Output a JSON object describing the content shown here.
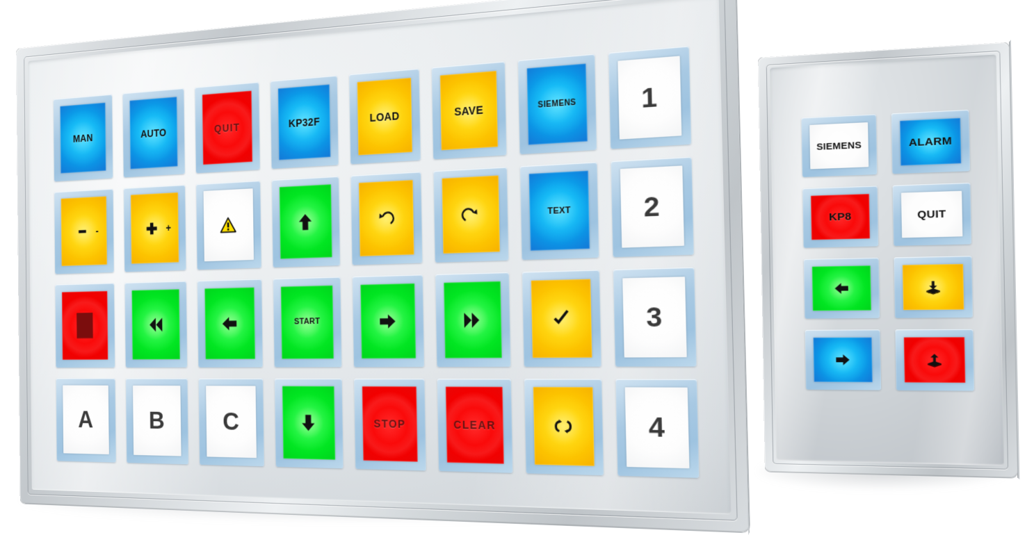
{
  "scene": {
    "background": "#ffffff",
    "bezel_color": "#d5d9dc",
    "key_bezel_color": "#9ec3e0",
    "accent_colors": {
      "blue": "#06b4f3",
      "green": "#0bf02b",
      "yellow": "#ffd200",
      "red": "#f20000",
      "white": "#ffffff"
    }
  },
  "panels": [
    {
      "id": "kp32f",
      "name": "main-keypad-panel",
      "columns": 8,
      "rows": 4,
      "keys": [
        {
          "label": "MAN",
          "color": "blue",
          "glyph": "",
          "size": "normal",
          "lamp": "blue"
        },
        {
          "label": "AUTO",
          "color": "blue",
          "glyph": "",
          "size": "normal",
          "lamp": "blue"
        },
        {
          "label": "QUIT",
          "color": "red",
          "glyph": "",
          "size": "faded",
          "lamp": "red"
        },
        {
          "label": "KP32F",
          "color": "blue",
          "glyph": "",
          "size": "normal",
          "lamp": "blue"
        },
        {
          "label": "LOAD",
          "color": "yellow",
          "glyph": "",
          "size": "normal",
          "lamp": "yellow"
        },
        {
          "label": "SAVE",
          "color": "yellow",
          "glyph": "",
          "size": "normal",
          "lamp": "yellow"
        },
        {
          "label": "SIEMENS",
          "color": "blue",
          "glyph": "",
          "size": "xsmall",
          "lamp": "blue"
        },
        {
          "label": "1",
          "color": "white",
          "glyph": "",
          "size": "big",
          "lamp": ""
        },
        {
          "label": "-",
          "color": "yellow",
          "glyph": "minus-icon",
          "size": "normal",
          "lamp": "yellow"
        },
        {
          "label": "+",
          "color": "yellow",
          "glyph": "plus-icon",
          "size": "normal",
          "lamp": "yellow"
        },
        {
          "label": "",
          "color": "white",
          "glyph": "warning-icon",
          "size": "normal",
          "lamp": ""
        },
        {
          "label": "",
          "color": "green",
          "glyph": "arrow-up-icon",
          "size": "normal",
          "lamp": "green"
        },
        {
          "label": "",
          "color": "yellow",
          "glyph": "undo-icon",
          "size": "normal",
          "lamp": "yellow"
        },
        {
          "label": "",
          "color": "yellow",
          "glyph": "redo-icon",
          "size": "normal",
          "lamp": "yellow"
        },
        {
          "label": "TEXT",
          "color": "blue",
          "glyph": "",
          "size": "small",
          "lamp": "blue"
        },
        {
          "label": "2",
          "color": "white",
          "glyph": "",
          "size": "big",
          "lamp": ""
        },
        {
          "label": "",
          "color": "red",
          "glyph": "stop-square-icon",
          "size": "normal",
          "lamp": "red"
        },
        {
          "label": "",
          "color": "green",
          "glyph": "rewind-icon",
          "size": "normal",
          "lamp": "green"
        },
        {
          "label": "",
          "color": "green",
          "glyph": "arrow-left-icon",
          "size": "normal",
          "lamp": "green"
        },
        {
          "label": "START",
          "color": "green",
          "glyph": "",
          "size": "small",
          "lamp": "green"
        },
        {
          "label": "",
          "color": "green",
          "glyph": "arrow-right-icon",
          "size": "normal",
          "lamp": "green"
        },
        {
          "label": "",
          "color": "green",
          "glyph": "fast-forward-icon",
          "size": "normal",
          "lamp": "green"
        },
        {
          "label": "",
          "color": "yellow",
          "glyph": "check-icon",
          "size": "normal",
          "lamp": "yellow"
        },
        {
          "label": "3",
          "color": "white",
          "glyph": "",
          "size": "big",
          "lamp": ""
        },
        {
          "label": "A",
          "color": "white",
          "glyph": "",
          "size": "big",
          "lamp": ""
        },
        {
          "label": "B",
          "color": "white",
          "glyph": "",
          "size": "big",
          "lamp": ""
        },
        {
          "label": "C",
          "color": "white",
          "glyph": "",
          "size": "big",
          "lamp": ""
        },
        {
          "label": "",
          "color": "green",
          "glyph": "arrow-down-icon",
          "size": "normal",
          "lamp": "green"
        },
        {
          "label": "STOP",
          "color": "red",
          "glyph": "",
          "size": "faded",
          "lamp": "red"
        },
        {
          "label": "CLEAR",
          "color": "red",
          "glyph": "",
          "size": "faded",
          "lamp": "red"
        },
        {
          "label": "",
          "color": "yellow",
          "glyph": "refresh-cycle-icon",
          "size": "normal",
          "lamp": "yellow"
        },
        {
          "label": "4",
          "color": "white",
          "glyph": "",
          "size": "big",
          "lamp": ""
        }
      ]
    },
    {
      "id": "kp8",
      "name": "small-keypad-panel",
      "columns": 2,
      "rows": 4,
      "keys": [
        {
          "label": "SIEMENS",
          "color": "white",
          "glyph": "",
          "size": "small",
          "lamp": ""
        },
        {
          "label": "ALARM",
          "color": "blue",
          "glyph": "",
          "size": "normal",
          "lamp": "blue"
        },
        {
          "label": "KP8",
          "color": "red",
          "glyph": "",
          "size": "normal",
          "lamp": "red"
        },
        {
          "label": "QUIT",
          "color": "white",
          "glyph": "",
          "size": "normal",
          "lamp": ""
        },
        {
          "label": "",
          "color": "green",
          "glyph": "arrow-left-icon",
          "size": "normal",
          "lamp": "green"
        },
        {
          "label": "",
          "color": "yellow",
          "glyph": "download-icon",
          "size": "normal",
          "lamp": "yellow"
        },
        {
          "label": "",
          "color": "blue",
          "glyph": "arrow-right-icon",
          "size": "normal",
          "lamp": "blue"
        },
        {
          "label": "",
          "color": "red",
          "glyph": "upload-icon",
          "size": "normal",
          "lamp": "red"
        }
      ]
    }
  ]
}
